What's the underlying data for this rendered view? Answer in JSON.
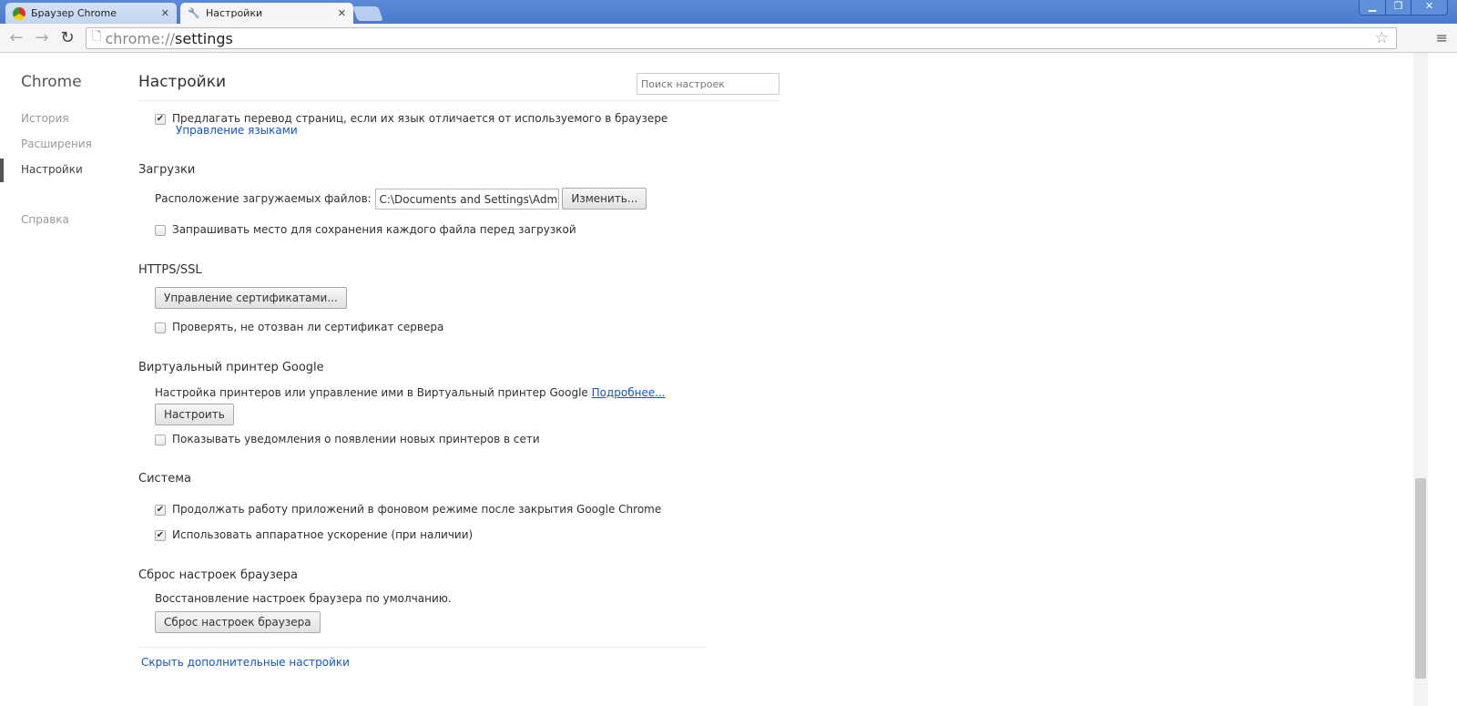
{
  "tabs": [
    {
      "label": "Браузер Chrome",
      "icon": "chrome-icon"
    },
    {
      "label": "Настройки",
      "icon": "wrench-icon"
    }
  ],
  "omnibox": {
    "scheme": "chrome://",
    "path": "settings"
  },
  "sidebar": {
    "brand": "Chrome",
    "items": [
      {
        "label": "История"
      },
      {
        "label": "Расширения"
      },
      {
        "label": "Настройки"
      },
      {
        "label": "Справка"
      }
    ]
  },
  "main": {
    "title": "Настройки",
    "search_placeholder": "Поиск настроек",
    "translate": {
      "label": "Предлагать перевод страниц, если их язык отличается от используемого в браузере",
      "checked": true,
      "link": "Управление языками"
    },
    "downloads": {
      "heading": "Загрузки",
      "location_label": "Расположение загружаемых файлов:",
      "location_value": "C:\\Documents and Settings\\Admin\\Мои документы",
      "change": "Изменить...",
      "ask_label": "Запрашивать место для сохранения каждого файла перед загрузкой",
      "ask_checked": false
    },
    "https": {
      "heading": "HTTPS/SSL",
      "manage": "Управление сертификатами...",
      "revocation_label": "Проверять, не отозван ли сертификат сервера",
      "revocation_checked": false
    },
    "cloudprint": {
      "heading": "Виртуальный принтер Google",
      "desc": "Настройка принтеров или управление ими в Виртуальный принтер Google",
      "more": "Подробнее...",
      "setup": "Настроить",
      "notify_label": "Показывать уведомления о появлении новых принтеров в сети",
      "notify_checked": false
    },
    "system": {
      "heading": "Система",
      "background_label": "Продолжать работу приложений в фоновом режиме после закрытия Google Chrome",
      "background_checked": true,
      "hw_label": "Использовать аппаратное ускорение (при наличии)",
      "hw_checked": true
    },
    "reset": {
      "heading": "Сброс настроек браузера",
      "desc": "Восстановление настроек браузера по умолчанию.",
      "button": "Сброс настроек браузера"
    },
    "hide_advanced": "Скрыть дополнительные настройки"
  }
}
